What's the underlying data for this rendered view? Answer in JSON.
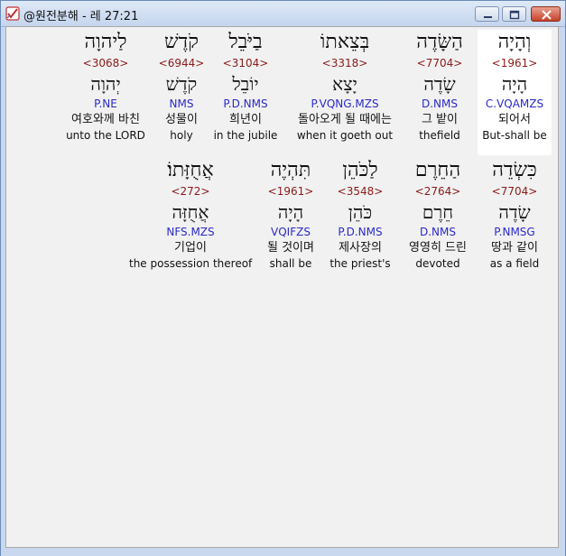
{
  "window": {
    "title": "@원전분해 - 레 27:21",
    "icon": "app-checkmark-icon"
  },
  "rows": [
    {
      "words": [
        {
          "heb": "וְהָיָה",
          "num": "<1961>",
          "lemma": "הָיָה",
          "parse": "C.VQAMZS",
          "kor": "되어서",
          "eng": "But-shall be",
          "selected": true
        },
        {
          "heb": "הַשָּׂדֶה",
          "num": "<7704>",
          "lemma": "שָׂדֶה",
          "parse": "D.NMS",
          "kor": "그 밭이",
          "eng": "thefield",
          "selected": false
        },
        {
          "heb": "בְּצֵאתוֹ",
          "num": "<3318>",
          "lemma": "יָצָא",
          "parse": "P.VQNG.MZS",
          "kor": "돌아오게 될 때에는",
          "eng": "when it goeth out",
          "selected": false
        },
        {
          "heb": "בַיֹּבֵל",
          "num": "<3104>",
          "lemma": "יוֹבֵל",
          "parse": "P.D.NMS",
          "kor": "희년이",
          "eng": "in the jubile",
          "selected": false
        },
        {
          "heb": "קֹדֶשׁ",
          "num": "<6944>",
          "lemma": "קֹדֶשׁ",
          "parse": "NMS",
          "kor": "성물이",
          "eng": "holy",
          "selected": false
        },
        {
          "heb": "לַיהוָה",
          "num": "<3068>",
          "lemma": "יְהוָה",
          "parse": "P.NE",
          "kor": "여호와께 바친",
          "eng": "unto the LORD",
          "selected": false
        }
      ]
    },
    {
      "words": [
        {
          "heb": "כִּשְׂדֵה",
          "num": "<7704>",
          "lemma": "שָׂדֶה",
          "parse": "P.NMSG",
          "kor": "땅과 같이",
          "eng": "as a field",
          "selected": false
        },
        {
          "heb": "הַחֵרֶם",
          "num": "<2764>",
          "lemma": "חֵרֶם",
          "parse": "D.NMS",
          "kor": "영영히 드린",
          "eng": "devoted",
          "selected": false
        },
        {
          "heb": "לַכֹּהֵן",
          "num": "<3548>",
          "lemma": "כֹּהֵן",
          "parse": "P.D.NMS",
          "kor": "제사장의",
          "eng": "the priest's",
          "selected": false
        },
        {
          "heb": "תִּהְיֶה",
          "num": "<1961>",
          "lemma": "הָיָה",
          "parse": "VQIFZS",
          "kor": "될 것이며",
          "eng": "shall be",
          "selected": false
        },
        {
          "heb": "אֲחֻזָּתוֹ׃",
          "num": "<272>",
          "lemma": "אֲחֻזָּה",
          "parse": "NFS.MZS",
          "kor": "기업이",
          "eng": "the possession thereof",
          "selected": false
        }
      ]
    }
  ]
}
